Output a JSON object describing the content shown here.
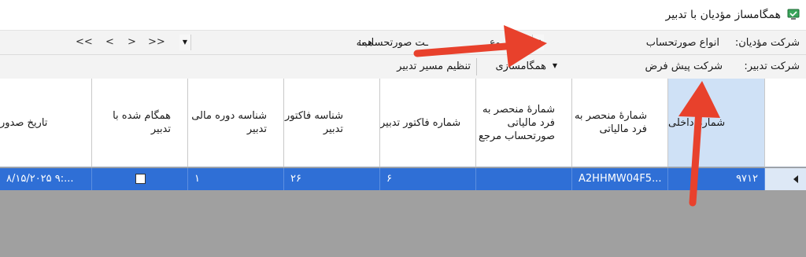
{
  "window": {
    "title": "همگامساز مؤدیان با تدبیر",
    "icon": "app-sync-icon"
  },
  "toolbar1": {
    "company_label": "شرکت مؤدیان:",
    "invoice_types_label": "انواع صورتحساب",
    "invoice_status_label": "ـت صورتحساب:",
    "invoice_status_value": "همه",
    "partial_text": "ـوع",
    "nav": {
      "last": "<<",
      "next": "<",
      "prev": ">",
      "first": ">>"
    }
  },
  "toolbar2": {
    "tadbir_company_label": "شرکت تدبیر:",
    "tadbir_company_value": "شرکت پیش فرض",
    "sync_button": "همگامسازی",
    "route_button": "تنظیم مسیر تدبیر"
  },
  "grid": {
    "headers": {
      "internal_no": "شمارۀ داخلی",
      "tax_id": "شمارۀ منحصر به فرد مالیاتی",
      "ref_tax_id": "شمارۀ منحصر به فرد مالیاتی صورتحساب مرجع",
      "tadbir_invoice_no": "شماره فاکتور تدبیر",
      "tadbir_invoice_id": "شناسه فاکتور تدبیر",
      "fiscal_period_id": "شناسه دوره مالی تدبیر",
      "synced": "همگام شده با تدبیر",
      "issue_date": "تاریخ صدور"
    },
    "rows": [
      {
        "internal_no": "۹۷۱۲",
        "tax_id": "A2HHMW04F5...",
        "ref_tax_id": "",
        "tadbir_invoice_no": "۶",
        "tadbir_invoice_id": "۲۶",
        "fiscal_period_id": "۱",
        "synced": false,
        "issue_date": "۸/۱۵/۲۰۲۵ ۹:..."
      }
    ]
  },
  "colors": {
    "selection": "#2f6fd6",
    "annotation_arrow": "#e8412c",
    "sorted_header": "#cfe1f6"
  }
}
